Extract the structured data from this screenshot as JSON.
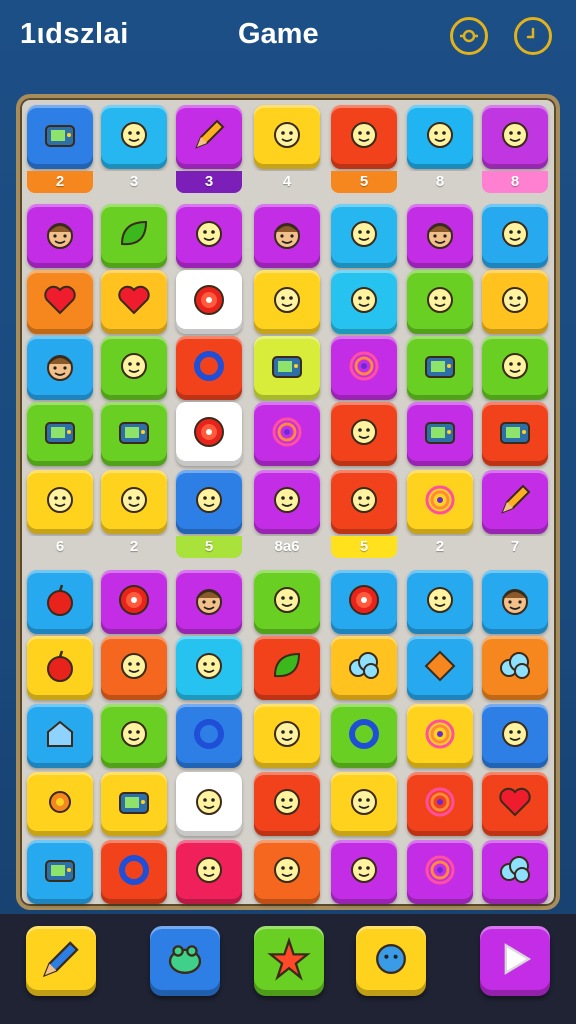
{
  "header": {
    "title_left": "1ιdszlai",
    "title_center": "Game",
    "settings_icon": "settings-icon",
    "timer_icon": "timer-icon"
  },
  "board": {
    "columns": 7,
    "badge_rows": [
      [
        "2",
        "3",
        "3",
        "4",
        "5",
        "8",
        "8"
      ],
      [
        "6",
        "2",
        "5",
        "8a6",
        "5",
        "2",
        "7"
      ]
    ],
    "rows": [
      [
        {
          "color": "#2d7fe6",
          "icon": "tv-icon"
        },
        {
          "color": "#27b7f0",
          "icon": "sun-flower-icon"
        },
        {
          "color": "#c42de6",
          "icon": "pencil-icon"
        },
        {
          "color": "#ffd21e",
          "icon": "red-blob-icon"
        },
        {
          "color": "#f2421c",
          "icon": "starfish-icon"
        },
        {
          "color": "#21b4f2",
          "icon": "flame-icon"
        },
        {
          "color": "#c036e0",
          "icon": "ribbon-bow-icon"
        }
      ],
      [
        {
          "color": "#c42de6",
          "icon": "face-icon"
        },
        {
          "color": "#69cf23",
          "icon": "leaf-face-icon"
        },
        {
          "color": "#c42de6",
          "icon": "yellow-face-icon"
        },
        {
          "color": "#c42de6",
          "icon": "face-icon"
        },
        {
          "color": "#27b7f0",
          "icon": "feather-icon"
        },
        {
          "color": "#c42de6",
          "icon": "face-icon"
        },
        {
          "color": "#27a9f0",
          "icon": "green-blob-face-icon"
        }
      ],
      [
        {
          "color": "#f5871e",
          "icon": "heart-icon"
        },
        {
          "color": "#ffc21e",
          "icon": "heart-icon"
        },
        {
          "color": "#ffffff",
          "icon": "target-icon"
        },
        {
          "color": "#ffd21e",
          "icon": "box-icon"
        },
        {
          "color": "#27c3f0",
          "icon": "brush-icon"
        },
        {
          "color": "#69cf23",
          "icon": "rocket-icon"
        },
        {
          "color": "#ffc21e",
          "icon": "bell-face-icon"
        }
      ],
      [
        {
          "color": "#27a9f0",
          "icon": "face-icon"
        },
        {
          "color": "#69cf23",
          "icon": "cat-face-icon"
        },
        {
          "color": "#f2421c",
          "icon": "ring-icon"
        },
        {
          "color": "#d8ec3a",
          "icon": "camera-icon"
        },
        {
          "color": "#c42de6",
          "icon": "swirl-icon"
        },
        {
          "color": "#69cf23",
          "icon": "film-icon"
        },
        {
          "color": "#69cf23",
          "icon": "dice-icon"
        }
      ],
      [
        {
          "color": "#69cf23",
          "icon": "ticket-icon"
        },
        {
          "color": "#69cf23",
          "icon": "frame-icon"
        },
        {
          "color": "#ffffff",
          "icon": "target-icon"
        },
        {
          "color": "#c42de6",
          "icon": "ripple-icon"
        },
        {
          "color": "#f2421c",
          "icon": "tag-icon"
        },
        {
          "color": "#c42de6",
          "icon": "cassette-icon"
        },
        {
          "color": "#f2421c",
          "icon": "camera-icon"
        }
      ],
      [
        {
          "color": "#ffd21e",
          "icon": "swirl-q-icon"
        },
        {
          "color": "#ffd21e",
          "icon": "candy-icon"
        },
        {
          "color": "#2d7fe6",
          "icon": "candy-icon"
        },
        {
          "color": "#c42de6",
          "icon": "cheese-icon"
        },
        {
          "color": "#f2421c",
          "icon": "cross-icon"
        },
        {
          "color": "#ffd21e",
          "icon": "spiral-icon"
        },
        {
          "color": "#c42de6",
          "icon": "pencil-icon"
        }
      ],
      [
        {
          "color": "#27a9f0",
          "icon": "apple-icon"
        },
        {
          "color": "#c42de6",
          "icon": "target-icon"
        },
        {
          "color": "#c42de6",
          "icon": "face-icon"
        },
        {
          "color": "#69cf23",
          "icon": "green-blob-face-icon"
        },
        {
          "color": "#27a9f0",
          "icon": "target-icon"
        },
        {
          "color": "#27a9f0",
          "icon": "balloon-face-icon"
        },
        {
          "color": "#27a9f0",
          "icon": "face-icon"
        }
      ],
      [
        {
          "color": "#ffd21e",
          "icon": "apple-icon"
        },
        {
          "color": "#f5671e",
          "icon": "monster-icon"
        },
        {
          "color": "#27c3f0",
          "icon": "feather-icon"
        },
        {
          "color": "#f2421c",
          "icon": "leaf-icon"
        },
        {
          "color": "#ffc21e",
          "icon": "cloud-blob-icon"
        },
        {
          "color": "#27a9f0",
          "icon": "diamond-icon"
        },
        {
          "color": "#f5871e",
          "icon": "clover-icon"
        }
      ],
      [
        {
          "color": "#27a9f0",
          "icon": "house-icon"
        },
        {
          "color": "#69cf23",
          "icon": "rose-icon"
        },
        {
          "color": "#2d7fe6",
          "icon": "ring-icon"
        },
        {
          "color": "#ffd21e",
          "icon": "robot-icon"
        },
        {
          "color": "#69cf23",
          "icon": "ring-icon"
        },
        {
          "color": "#ffd21e",
          "icon": "spiral-icon"
        },
        {
          "color": "#2d7fe6",
          "icon": "fish-face-icon"
        }
      ],
      [
        {
          "color": "#ffd21e",
          "icon": "gear-icon"
        },
        {
          "color": "#ffd21e",
          "icon": "battery-icon"
        },
        {
          "color": "#ffffff",
          "icon": "arch-icon"
        },
        {
          "color": "#f2421c",
          "icon": "bottle-icon"
        },
        {
          "color": "#ffd21e",
          "icon": "stamp-icon"
        },
        {
          "color": "#f2421c",
          "icon": "swirl-icon"
        },
        {
          "color": "#f2421c",
          "icon": "heart-icon"
        }
      ],
      [
        {
          "color": "#27a9f0",
          "icon": "radio-icon"
        },
        {
          "color": "#f2421c",
          "icon": "ring-icon"
        },
        {
          "color": "#f0215a",
          "icon": "coin-s-icon"
        },
        {
          "color": "#f5671e",
          "icon": "orange-face-icon"
        },
        {
          "color": "#c42de6",
          "icon": "plum-icon"
        },
        {
          "color": "#c42de6",
          "icon": "spiral-icon"
        },
        {
          "color": "#c42de6",
          "icon": "cloud-icon"
        }
      ]
    ]
  },
  "toolbar": [
    {
      "color": "#ffd21e",
      "icon": "pencil-tool-icon"
    },
    {
      "color": "#2d7fe6",
      "icon": "frog-tool-icon"
    },
    {
      "color": "#69cf23",
      "icon": "star-tool-icon"
    },
    {
      "color": "#ffd21e",
      "icon": "gear-tool-icon"
    },
    {
      "color": "#c42de6",
      "icon": "play-icon"
    }
  ]
}
